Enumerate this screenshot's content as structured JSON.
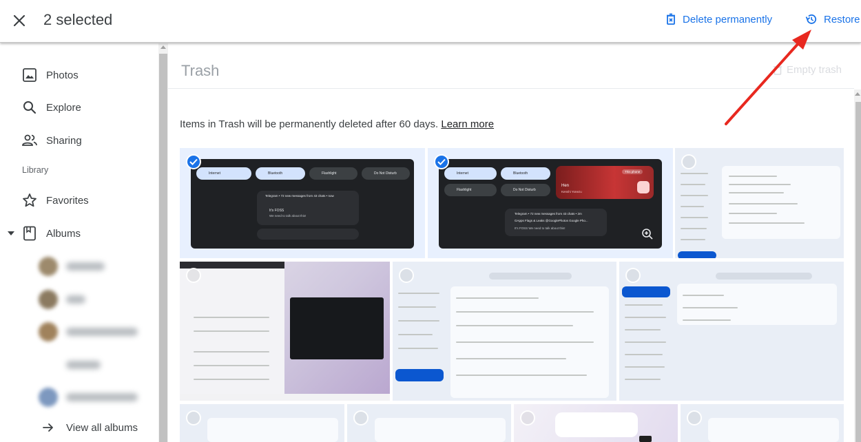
{
  "topbar": {
    "selected_label": "2 selected",
    "delete_label": "Delete permanently",
    "restore_label": "Restore",
    "close_icon": "close-icon",
    "delete_icon": "delete-forever-icon",
    "restore_icon": "restore-icon",
    "accent": "#1a73e8"
  },
  "sidebar": {
    "items": [
      {
        "label": "Photos",
        "icon": "photo-icon"
      },
      {
        "label": "Explore",
        "icon": "search-icon"
      },
      {
        "label": "Sharing",
        "icon": "people-icon"
      }
    ],
    "library_label": "Library",
    "library_items": [
      {
        "label": "Favorites",
        "icon": "star-icon"
      },
      {
        "label": "Albums",
        "icon": "album-icon"
      }
    ],
    "view_all_label": "View all albums"
  },
  "main": {
    "title": "Trash",
    "empty_trash_label": "Empty trash",
    "info_text": "Items in Trash will be permanently deleted after 60 days. ",
    "learn_more": "Learn more"
  },
  "thumbs": {
    "s1": {
      "pills": [
        "Internet",
        "Bluetooth",
        "Flashlight",
        "Do Not Disturb"
      ],
      "notif_title": "Telegram • 72 new messages from 43 chats • now",
      "notif_sender": "It's FOSS",
      "notif_body": "We need to talk about this!"
    },
    "s2": {
      "pills": [
        "Internet",
        "Bluetooth",
        "Flashlight",
        "Do Not Disturb"
      ],
      "media_title": "Hen",
      "media_artist": "Kenshi Yonezu",
      "media_badge": "This phone",
      "notif_title": "Telegram • 72 new messages from 43 chats • 2m",
      "notif_sub": "GApps Flags & Leaks @GooglePhotos Google Pho...",
      "notif_body": "It's FOSS  We need to talk about this!"
    }
  },
  "annotation": {
    "color": "#e8281f"
  }
}
